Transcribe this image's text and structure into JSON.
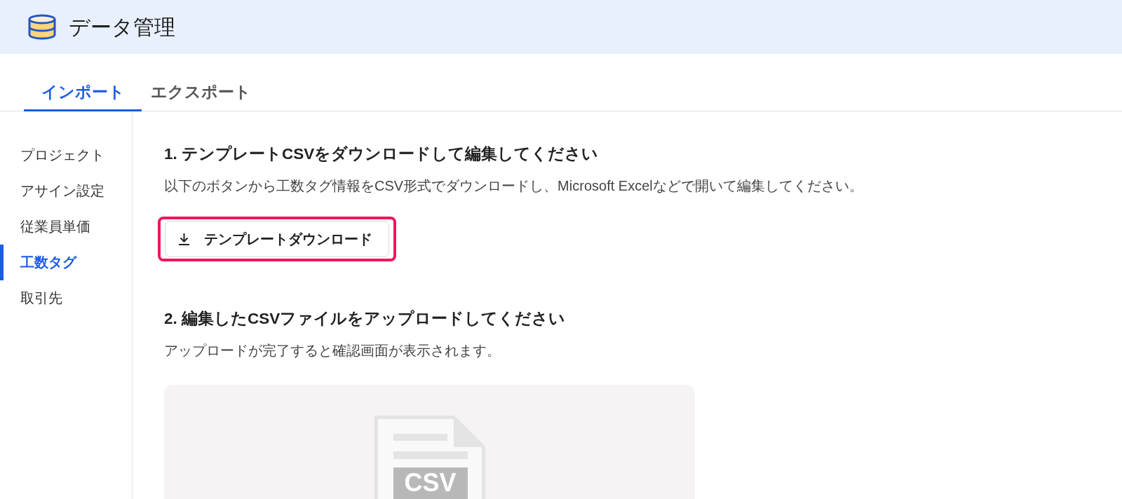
{
  "header": {
    "title": "データ管理"
  },
  "tabs": [
    {
      "label": "インポート",
      "selected": true
    },
    {
      "label": "エクスポート",
      "selected": false
    }
  ],
  "sidebar": {
    "items": [
      {
        "label": "プロジェクト",
        "selected": false
      },
      {
        "label": "アサイン設定",
        "selected": false
      },
      {
        "label": "従業員単価",
        "selected": false
      },
      {
        "label": "工数タグ",
        "selected": true
      },
      {
        "label": "取引先",
        "selected": false
      }
    ]
  },
  "steps": [
    {
      "kind": "download",
      "heading": "1. テンプレートCSVをダウンロードして編集してください",
      "description": "以下のボタンから工数タグ情報をCSV形式でダウンロードし、Microsoft Excelなどで開いて編集してください。",
      "button": {
        "label": "テンプレートダウンロード",
        "highlighted": true
      }
    },
    {
      "kind": "upload",
      "heading": "2. 編集したCSVファイルをアップロードしてください",
      "description": "アップロードが完了すると確認画面が表示されます。",
      "upload_area": {
        "file_type": "CSV"
      }
    }
  ]
}
